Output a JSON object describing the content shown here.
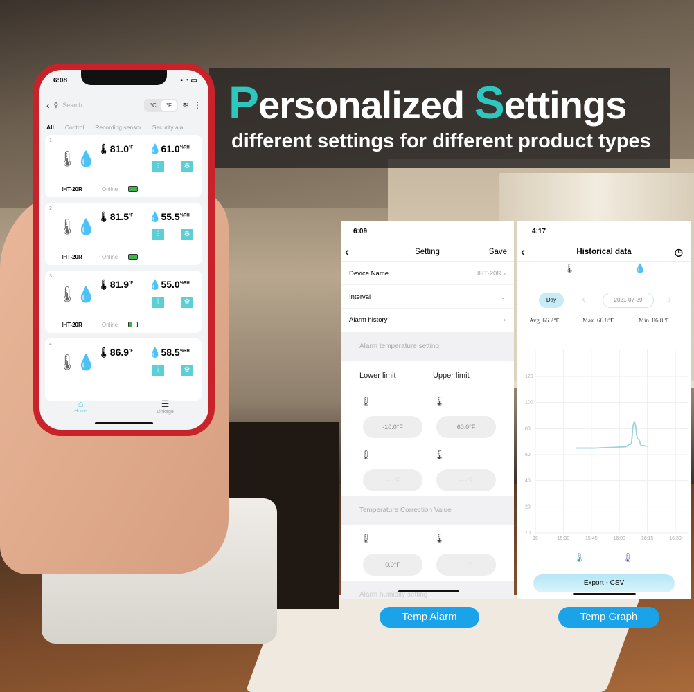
{
  "banner": {
    "title_p": "P",
    "title_rest1": "ersonalized ",
    "title_s": "S",
    "title_rest2": "ettings",
    "subtitle": "different settings for different product types",
    "accent": "#2ec7c0"
  },
  "phone_home": {
    "time": "6:08",
    "search_placeholder": "Search",
    "unit_c": "°C",
    "unit_f": "°F",
    "tabs": [
      "All",
      "Control",
      "Recording sensor",
      "Security ala"
    ],
    "devices": [
      {
        "index": "1",
        "temp": "81.0",
        "temp_unit": "°F",
        "humidity": "61.0",
        "hum_unit": "%RH",
        "model": "IHT-20R",
        "status": "Online",
        "battery": 1.0
      },
      {
        "index": "2",
        "temp": "81.5",
        "temp_unit": "°F",
        "humidity": "55.5",
        "hum_unit": "%RH",
        "model": "IHT-20R",
        "status": "Online",
        "battery": 1.0
      },
      {
        "index": "3",
        "temp": "81.9",
        "temp_unit": "°F",
        "humidity": "55.0",
        "hum_unit": "%RH",
        "model": "IHT-20R",
        "status": "Online",
        "battery": 0.3
      },
      {
        "index": "4",
        "temp": "86.9",
        "temp_unit": "°F",
        "humidity": "58.5",
        "hum_unit": "%RH"
      }
    ],
    "nav": [
      "Home",
      "Linkage"
    ]
  },
  "setting_screen": {
    "time": "6:09",
    "title": "Setting",
    "save": "Save",
    "device_name_label": "Device Name",
    "device_name_value": "IHT-20R",
    "interval_label": "Interval",
    "alarm_history_label": "Alarm history",
    "alarm_temp_section": "Alarm temperature setting",
    "lower_limit": "Lower limit",
    "upper_limit": "Upper limit",
    "lower_value": "-10.0°F",
    "upper_value": "60.0°F",
    "probe_lower": "--.-°F",
    "probe_upper": "--.-°F",
    "correction_section": "Temperature Correction Value",
    "correction_value": "0.0°F",
    "correction_probe": "--.-°F",
    "humidity_section": "Alarm humidity setting"
  },
  "history_screen": {
    "time": "4:17",
    "title": "Historical data",
    "period": "Day",
    "date": "2021-07-29",
    "avg_label": "Avg",
    "avg": "66.2℉",
    "max_label": "Max",
    "max": "66.8℉",
    "min_label": "Min",
    "min": "86.8℉",
    "export": "Export - CSV"
  },
  "chart_data": {
    "type": "line",
    "x_ticks": [
      "15",
      "15:30",
      "15:45",
      "16:00",
      "16:15",
      "16:30"
    ],
    "y_ticks": [
      "10",
      "20",
      "40",
      "60",
      "80",
      "100",
      "120"
    ],
    "ylim": [
      0,
      120
    ],
    "grid": true,
    "color": "#9fd3dc",
    "x": [
      "15:37",
      "15:45",
      "15:55",
      "16:03",
      "16:06",
      "16:08",
      "16:10",
      "16:12",
      "16:15"
    ],
    "y": [
      65,
      65,
      65.5,
      66,
      68,
      85,
      72,
      67,
      66.5
    ]
  },
  "captions": {
    "left": "Temp Alarm",
    "right": "Temp Graph"
  }
}
